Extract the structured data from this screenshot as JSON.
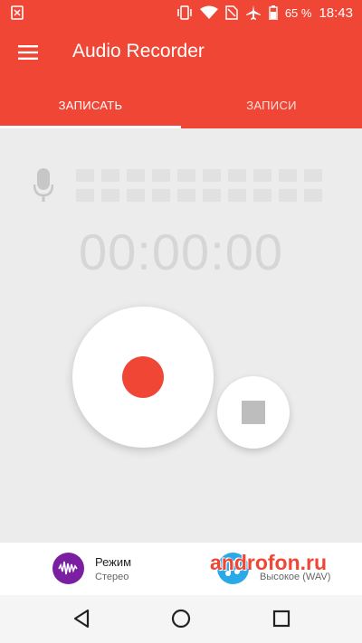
{
  "status_bar": {
    "battery_percent": "65 %",
    "time": "18:43"
  },
  "app": {
    "title": "Audio Recorder"
  },
  "tabs": [
    {
      "label": "ЗАПИСАТЬ",
      "active": true
    },
    {
      "label": "ЗАПИСИ",
      "active": false
    }
  ],
  "recorder": {
    "timer": "00:00:00",
    "level_rows": 2,
    "level_columns": 10
  },
  "settings": {
    "mode": {
      "title": "Режим",
      "value": "Стерео",
      "icon": "waveform-icon"
    },
    "quality": {
      "title": "",
      "value": "Высокое (WAV)",
      "icon": "music-note-icon"
    }
  },
  "watermark": "androfon.ru",
  "colors": {
    "accent": "#ef4636",
    "mode_icon": "#7b1fa2",
    "quality_icon": "#29a9e6"
  }
}
